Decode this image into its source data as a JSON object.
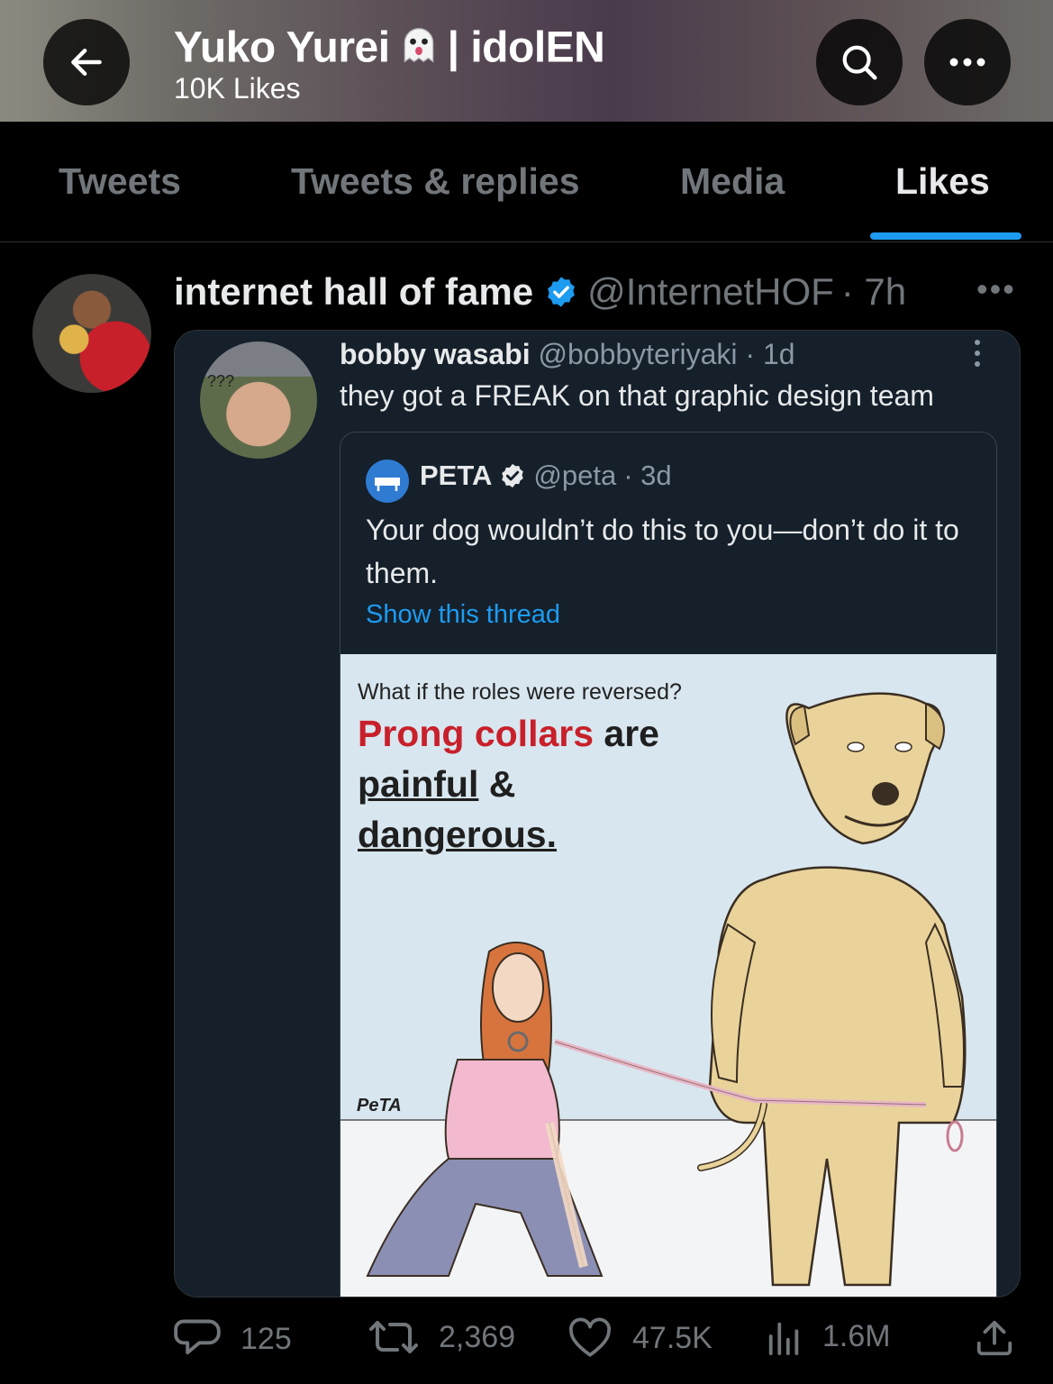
{
  "header": {
    "title": "Yuko Yurei",
    "title_suffix": "| idolEN",
    "title_emoji": "ghost",
    "subtitle": "10K Likes",
    "back_icon": "arrow-left-icon",
    "search_icon": "search-icon",
    "more_icon": "more-horizontal-icon"
  },
  "tabs": [
    {
      "label": "Tweets",
      "active": false
    },
    {
      "label": "Tweets & replies",
      "active": false
    },
    {
      "label": "Media",
      "active": false
    },
    {
      "label": "Likes",
      "active": true
    }
  ],
  "tweet": {
    "author_name": "internet hall of fame",
    "verified": true,
    "handle": "@InternetHOF",
    "time": "· 7h",
    "embed": {
      "author_name": "bobby wasabi",
      "handle": "@bobbyteriyaki",
      "time": "· 1d",
      "text": "they got a FREAK on that graphic design team",
      "avatar_caption": "???",
      "quote": {
        "author_name": "PETA",
        "verified": true,
        "handle": "@peta",
        "time": "· 3d",
        "text": "Your dog wouldn’t do this to you—don’t do it to them.",
        "show_thread": "Show this thread",
        "image": {
          "question": "What if the roles were reversed?",
          "headline_red": "Prong collars",
          "headline_1": " are",
          "headline_2": "painful",
          "headline_3": " &",
          "headline_4": "dangerous.",
          "signature": "PeTA"
        }
      }
    },
    "stats": {
      "replies": "125",
      "retweets": "2,369",
      "likes": "47.5K",
      "views": "1.6M"
    }
  },
  "colors": {
    "accent": "#1d9bf0",
    "muted": "#71767b",
    "peta_red": "#c8202a"
  }
}
